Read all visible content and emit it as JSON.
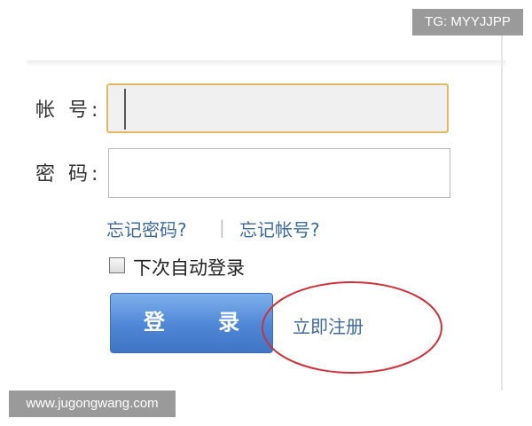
{
  "overlay": {
    "tg_label": "TG: MYYJJPP",
    "watermark": "www.jugongwang.com"
  },
  "form": {
    "account_label": "帐 号:",
    "account_value": "",
    "password_label": "密 码:",
    "password_value": "",
    "forgot_password": "忘记密码?",
    "separator": "|",
    "forgot_account": "忘记帐号?",
    "remember_me": "下次自动登录",
    "remember_me_checked": false,
    "login_button": "登 录",
    "register_link": "立即注册"
  },
  "colors": {
    "link": "#3d6b9c",
    "login_button": "#4e86d6",
    "focus_border": "#e3b863",
    "annotation_circle": "#d0303a"
  }
}
